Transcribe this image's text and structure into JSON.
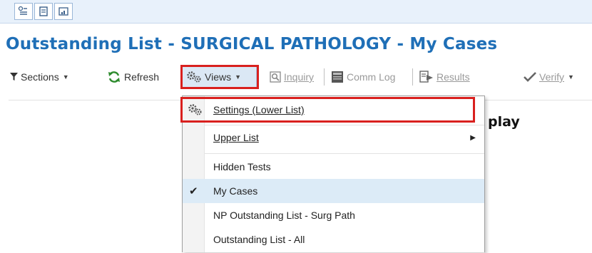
{
  "page": {
    "title": "Outstanding List - SURGICAL PATHOLOGY - My Cases"
  },
  "top_strip": {
    "buttons": [
      {
        "icon": "filter-list-icon"
      },
      {
        "icon": "document-list-icon"
      },
      {
        "icon": "chart-window-icon"
      }
    ]
  },
  "toolbar": {
    "sections_label": "Sections",
    "refresh_label": "Refresh",
    "views_label": "Views",
    "inquiry_label": "Inquiry",
    "commlog_label": "Comm Log",
    "results_label": "Results",
    "verify_label": "Verify"
  },
  "main": {
    "partial_text": "play"
  },
  "views_menu": {
    "settings_label": "Settings (Lower List)",
    "upper_list_label": "Upper List",
    "hidden_tests_label": "Hidden Tests",
    "my_cases_label": "My Cases",
    "np_outstanding_label": "NP Outstanding List - Surg Path",
    "outstanding_all_label": "Outstanding List - All"
  },
  "colors": {
    "accent": "#1f6fb7",
    "highlight": "#d9201e",
    "menu_selected": "#dcebf7"
  }
}
